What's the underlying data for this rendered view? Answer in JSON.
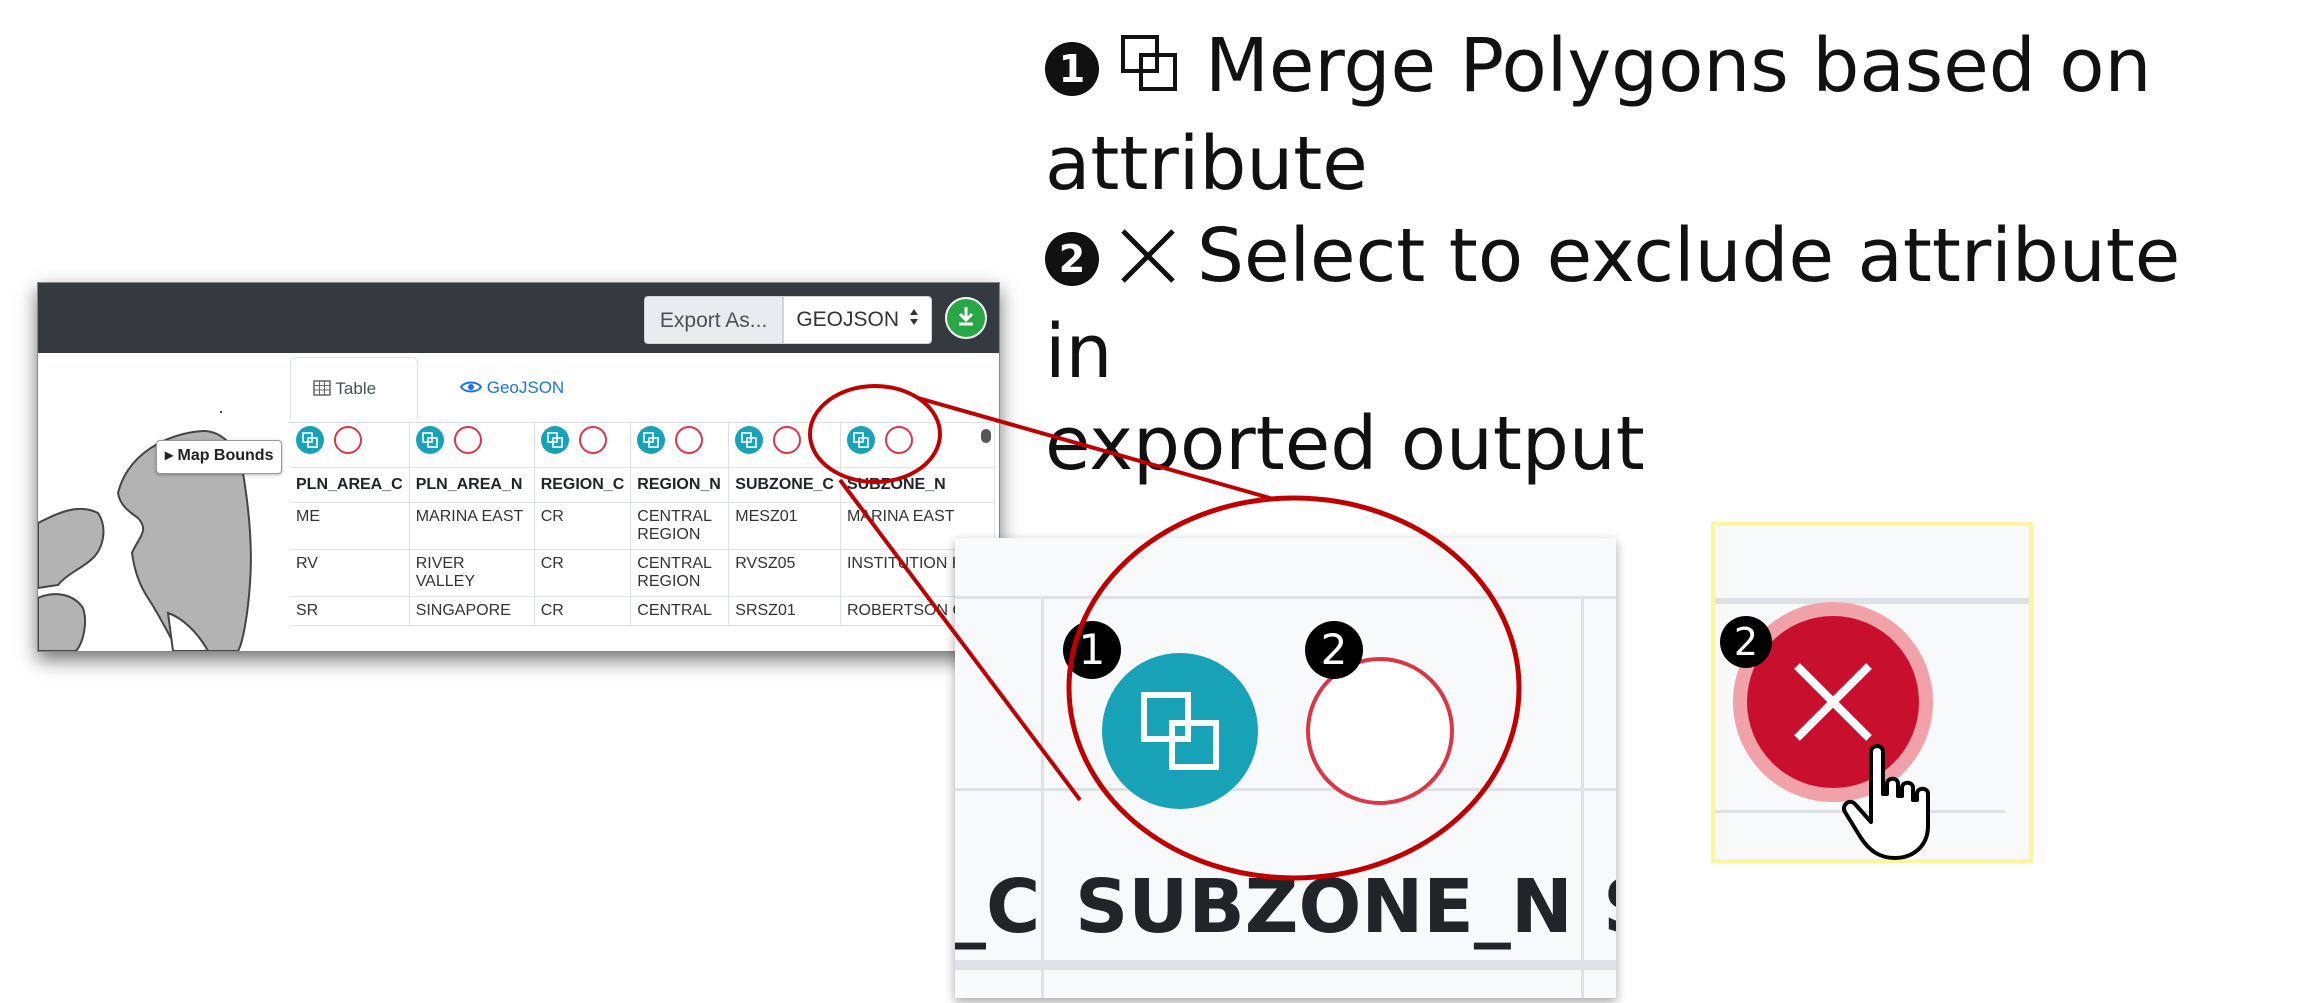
{
  "instructions": {
    "line1_text": "Merge Polygons based on",
    "line1_cont": "attribute",
    "line2_text": "Select to exclude attribute in",
    "line2_cont": "exported output",
    "badge1": "1",
    "badge2": "2"
  },
  "toolbar": {
    "export_label": "Export As...",
    "format_value": "GEOJSON"
  },
  "map": {
    "bounds_button": "Map Bounds"
  },
  "tabs": {
    "table": "Table",
    "geojson": "GeoJSON"
  },
  "table": {
    "headers": [
      "PLN_AREA_C",
      "PLN_AREA_N",
      "REGION_C",
      "REGION_N",
      "SUBZONE_C",
      "SUBZONE_N"
    ],
    "rows": [
      [
        "ME",
        "MARINA EAST",
        "CR",
        "CENTRAL REGION",
        "MESZ01",
        "MARINA EAST"
      ],
      [
        "RV",
        "RIVER VALLEY",
        "CR",
        "CENTRAL REGION",
        "RVSZ05",
        "INSTITUTION HI"
      ],
      [
        "SR",
        "SINGAPORE",
        "CR",
        "CENTRAL",
        "SRSZ01",
        "ROBERTSON QU"
      ]
    ]
  },
  "zoom": {
    "left_text": "_C",
    "header_text": "SUBZONE_N",
    "right_text": "S",
    "badge1": "1",
    "badge2": "2"
  },
  "hover": {
    "badge": "2"
  },
  "colors": {
    "merge": "#17a2b8",
    "exclude": "#dc3545",
    "callout": "#c00000",
    "download": "#28a745",
    "topbar": "#343a40"
  }
}
